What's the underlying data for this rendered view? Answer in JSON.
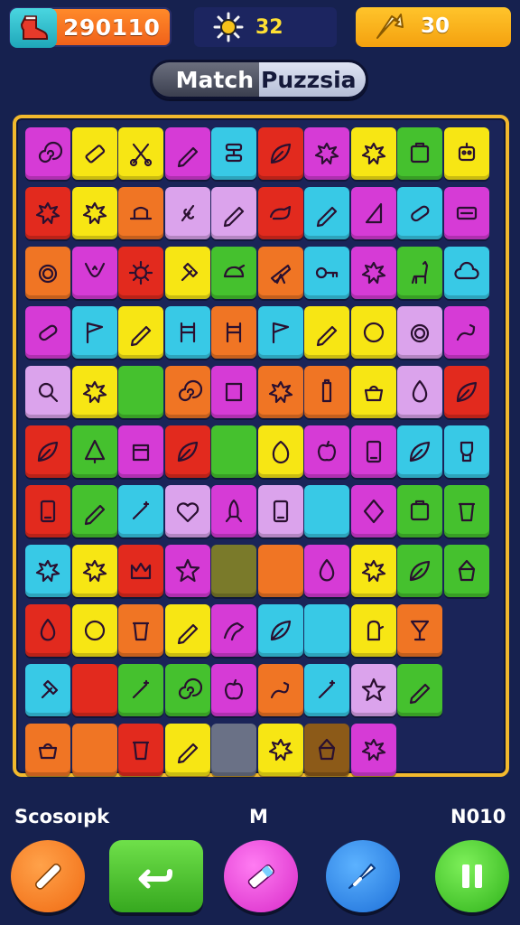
{
  "hud": {
    "score": "290110",
    "center_value": "32",
    "coins": "30",
    "icons": {
      "score": "boot-icon",
      "center": "sun-icon",
      "coins": "arrow-icon"
    }
  },
  "title": {
    "left": "Match",
    "right": "Puzzsia"
  },
  "footer": {
    "left_label": "Scosoıpk",
    "middle_label": "M",
    "right_label": "N010"
  },
  "buttons": [
    {
      "name": "pencil-button",
      "icon": "pencil-icon",
      "color": "#f47a1f"
    },
    {
      "name": "undo-button",
      "icon": "undo-icon",
      "color": "#4cc933"
    },
    {
      "name": "magic-wand-button",
      "icon": "marker-icon",
      "color": "#e93ad6"
    },
    {
      "name": "hint-button",
      "icon": "rocket-icon",
      "color": "#2f8be8"
    },
    {
      "name": "pause-button",
      "icon": "pause-icon",
      "color": "#4fd33a"
    }
  ],
  "palette": {
    "M": "#d63bd6",
    "Y": "#f7e614",
    "R": "#e22a1e",
    "O": "#f07524",
    "C": "#38c9e6",
    "G": "#45c12e",
    "P": "#dba3ec",
    "D": "#7a7a2a",
    "S": "#6a7186",
    "L": "#8c5a18"
  },
  "board": {
    "rows": [
      [
        "M",
        "Y",
        "Y",
        "M",
        "C",
        "R",
        "M",
        "Y",
        "G",
        "Y"
      ],
      [
        "R",
        "Y",
        "O",
        "P",
        "P",
        "R",
        "C",
        "M",
        "C",
        "M"
      ],
      [
        "O",
        "M",
        "R",
        "Y",
        "G",
        "O",
        "C",
        "M",
        "G",
        "C"
      ],
      [
        "M",
        "C",
        "Y",
        "C",
        "O",
        "C",
        "Y",
        "Y",
        "P",
        "M"
      ],
      [
        "P",
        "Y",
        "G",
        "O",
        "M",
        "O",
        "O",
        "Y",
        "P",
        "R"
      ],
      [
        "R",
        "G",
        "M",
        "R",
        "G",
        "Y",
        "M",
        "M",
        "C",
        "C"
      ],
      [
        "R",
        "G",
        "C",
        "P",
        "M",
        "P",
        "C",
        "M",
        "G",
        "G"
      ],
      [
        "C",
        "Y",
        "R",
        "M",
        "D",
        "O",
        "M",
        "Y",
        "G",
        "G"
      ],
      [
        "R",
        "Y",
        "O",
        "Y",
        "M",
        "C",
        "C",
        "Y",
        "O",
        ""
      ],
      [
        "C",
        "R",
        "G",
        "G",
        "M",
        "O",
        "C",
        "P",
        "G",
        ""
      ],
      [
        "O",
        "O",
        "R",
        "Y",
        "S",
        "Y",
        "L",
        "M",
        "",
        ""
      ]
    ],
    "icons": [
      [
        "spiral-icon",
        "eraser-icon",
        "scissors-icon",
        "pencil-icon",
        "glasses-icon",
        "leaf-icon",
        "splat-icon",
        "splat-icon",
        "frame-icon",
        "robot-icon"
      ],
      [
        "splat-icon",
        "splat-icon",
        "hat-icon",
        "pin-icon",
        "pencil-icon",
        "rhino-icon",
        "pencil-icon",
        "triangle-icon",
        "capsule-icon",
        "stamp-icon"
      ],
      [
        "ring-icon",
        "deer-icon",
        "sun-icon",
        "hammer-icon",
        "turtle-icon",
        "telescope-icon",
        "key-icon",
        "splat-icon",
        "llama-icon",
        "cloud-icon"
      ],
      [
        "capsule-icon",
        "flag-icon",
        "pencil-icon",
        "chair-icon",
        "chair-icon",
        "flag-icon",
        "pencil-icon",
        "circle-icon",
        "ring-icon",
        "scorpion-icon"
      ],
      [
        "magnifier-icon",
        "splat-icon",
        "",
        "spiral-icon",
        "square-icon",
        "splat-icon",
        "bottle-icon",
        "pot-icon",
        "drop-icon",
        "leaf-icon"
      ],
      [
        "leaf-icon",
        "tree-icon",
        "box-icon",
        "leaf-icon",
        "",
        "egg-icon",
        "apple-icon",
        "phone-icon",
        "leaf-icon",
        "toilet-icon"
      ],
      [
        "phone-icon",
        "pencil-icon",
        "wand-icon",
        "heart-icon",
        "rocket-icon",
        "phone-icon",
        "",
        "diamond-icon",
        "frame-icon",
        "cup-icon"
      ],
      [
        "splat-icon",
        "splat-icon",
        "crown-icon",
        "star-icon",
        "",
        "",
        "drop-icon",
        "splat-icon",
        "leaf-icon",
        "crystal-icon"
      ],
      [
        "drop-icon",
        "circle-icon",
        "cup-icon",
        "pencil-icon",
        "dragon-icon",
        "leaf-icon",
        "",
        "mitten-icon",
        "glass-icon",
        ""
      ],
      [
        "hammer-icon",
        "",
        "wand-icon",
        "spiral-icon",
        "apple-icon",
        "scorpion-icon",
        "wand-icon",
        "star-icon",
        "pencil-icon",
        ""
      ],
      [
        "pot-icon",
        "",
        "cup-icon",
        "pencil-icon",
        "",
        "splat-icon",
        "crystal-icon",
        "splat-icon",
        "",
        ""
      ]
    ]
  }
}
